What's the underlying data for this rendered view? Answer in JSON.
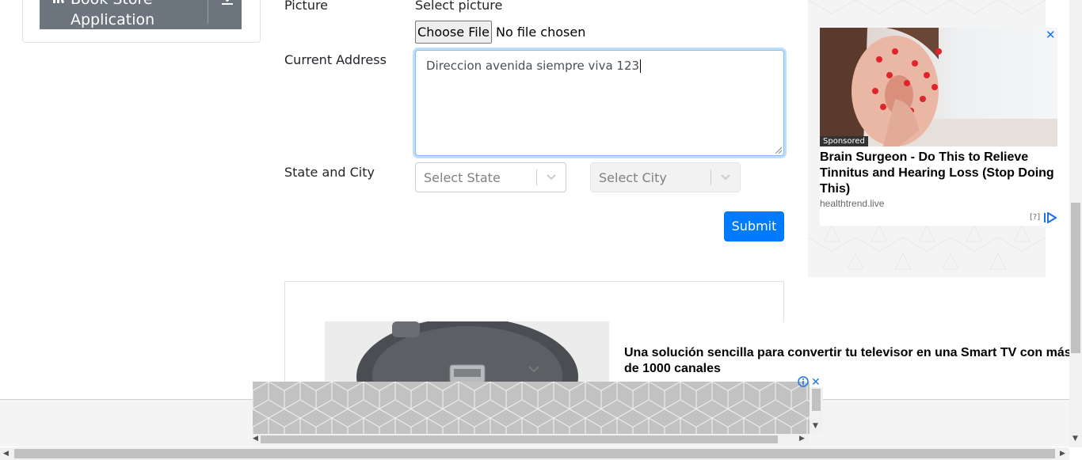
{
  "sidebar": {
    "accordion_title": "Book Store\nApplication",
    "accordion_title_line1": "Book Store",
    "accordion_title_line2": "Application"
  },
  "form": {
    "picture_label": "Picture",
    "picture_hint": "Select picture",
    "file_button": "Choose File",
    "file_status": "No file chosen",
    "address_label": "Current Address",
    "address_value": "Direccion avenida siempre viva 123",
    "state_city_label": "State and City",
    "state_placeholder": "Select State",
    "city_placeholder": "Select City",
    "submit_label": "Submit"
  },
  "sponsored_widget": {
    "tag": "Sponsored",
    "headline": "Brain Surgeon - Do This to Relieve Tinnitus and Hearing Loss (Stop Doing This)",
    "domain": "healthtrend.live",
    "help": "[?]",
    "close_symbol": "✕"
  },
  "bottom_ad": {
    "headline": "Una solución sencilla para convertir tu televisor en una Smart TV con más de 1000 canales"
  },
  "footer_ad": {
    "close_symbol": "✕"
  },
  "colors": {
    "primary": "#007bff",
    "accordion_bg": "#6c757d",
    "ad_close": "#1a73e8"
  }
}
